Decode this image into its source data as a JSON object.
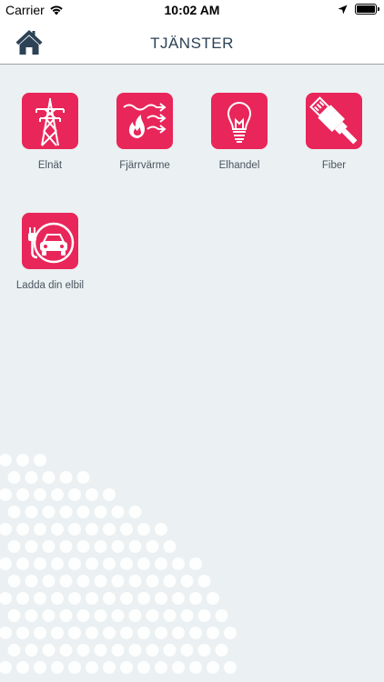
{
  "status_bar": {
    "carrier": "Carrier",
    "time": "10:02 AM"
  },
  "nav": {
    "title": "TJÄNSTER",
    "home_icon": "home-icon"
  },
  "colors": {
    "accent": "#e8265a",
    "nav_text": "#2c4256",
    "background": "#ebf0f2"
  },
  "services": [
    {
      "label": "Elnät",
      "icon": "power-pylon-icon"
    },
    {
      "label": "Fjärrvärme",
      "icon": "district-heating-icon"
    },
    {
      "label": "Elhandel",
      "icon": "light-bulb-icon"
    },
    {
      "label": "Fiber",
      "icon": "ethernet-cable-icon"
    },
    {
      "label": "Ladda din elbil",
      "icon": "ev-charging-icon"
    }
  ]
}
